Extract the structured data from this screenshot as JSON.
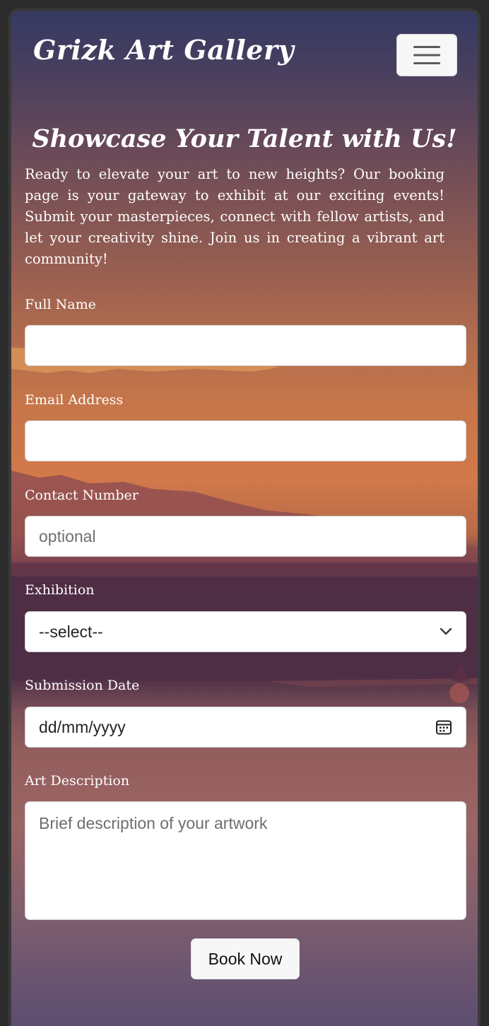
{
  "navbar": {
    "brand": "Grizk Art Gallery",
    "toggler_icon": "hamburger-menu-icon"
  },
  "hero": {
    "heading": "Showcase Your Talent with Us!",
    "intro": "Ready to elevate your art to new heights? Our booking page is your gateway to exhibit at our exciting events! Submit your masterpieces, connect with fellow artists, and let your creativity shine. Join us in creating a vibrant art community!"
  },
  "form": {
    "full_name": {
      "label": "Full Name",
      "value": "",
      "placeholder": ""
    },
    "email": {
      "label": "Email Address",
      "value": "",
      "placeholder": ""
    },
    "contact": {
      "label": "Contact Number",
      "value": "",
      "placeholder": "optional"
    },
    "exhibition": {
      "label": "Exhibition",
      "selected": "--select--",
      "icon": "chevron-down-icon"
    },
    "date": {
      "label": "Submission Date",
      "value": "dd/mm/yyyy",
      "icon": "calendar-icon"
    },
    "description": {
      "label": "Art Description",
      "value": "",
      "placeholder": "Brief description of your artwork"
    },
    "submit_label": "Book Now"
  },
  "colors": {
    "text": "#ffffff",
    "field_bg": "#ffffff",
    "button_bg": "#f7f7f8"
  }
}
